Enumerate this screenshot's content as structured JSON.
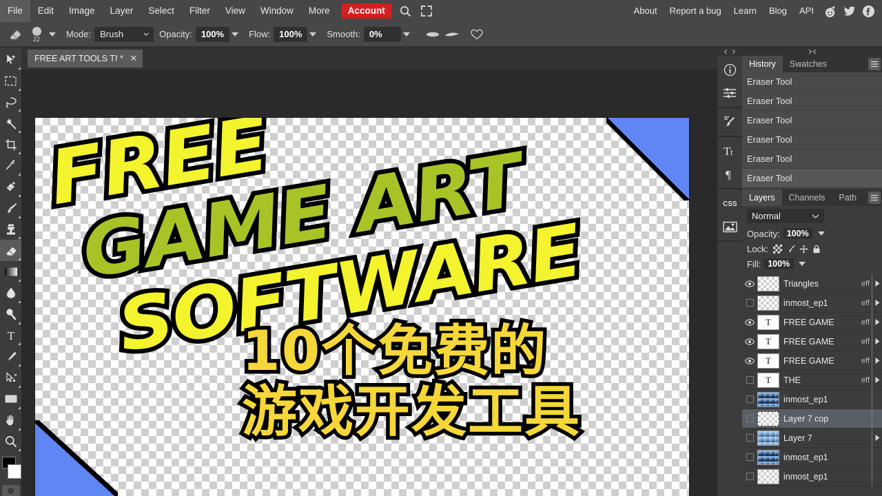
{
  "menu": {
    "left_items": [
      {
        "label": "File",
        "name": "menu-file"
      },
      {
        "label": "Edit",
        "name": "menu-edit"
      },
      {
        "label": "Image",
        "name": "menu-image"
      },
      {
        "label": "Layer",
        "name": "menu-layer"
      },
      {
        "label": "Select",
        "name": "menu-select"
      },
      {
        "label": "Filter",
        "name": "menu-filter"
      },
      {
        "label": "View",
        "name": "menu-view"
      },
      {
        "label": "Window",
        "name": "menu-window"
      },
      {
        "label": "More",
        "name": "menu-more"
      }
    ],
    "account_label": "Account",
    "account_color": "#d21f21",
    "search_icon": "search-icon",
    "fullscreen_icon": "fullscreen-icon",
    "right_items": [
      {
        "label": "About",
        "name": "menu-about"
      },
      {
        "label": "Report a bug",
        "name": "menu-report-a-bug"
      },
      {
        "label": "Learn",
        "name": "menu-learn"
      },
      {
        "label": "Blog",
        "name": "menu-blog"
      },
      {
        "label": "API",
        "name": "menu-api"
      }
    ],
    "social": [
      {
        "name": "reddit-icon"
      },
      {
        "name": "twitter-icon"
      },
      {
        "name": "facebook-icon"
      }
    ]
  },
  "options_bar": {
    "tool_icon": "eraser-icon",
    "brush_size": "22",
    "mode_label": "Mode:",
    "mode_value": "Brush",
    "opacity_label": "Opacity:",
    "opacity_value": "100%",
    "flow_label": "Flow:",
    "flow_value": "100%",
    "smooth_label": "Smooth:",
    "smooth_value": "0%",
    "extra_icons": [
      "airbrush-icon",
      "pressure-icon",
      "heart-icon"
    ]
  },
  "toolbar": {
    "tools": [
      {
        "name": "move-tool",
        "active": false
      },
      {
        "name": "marquee-tool",
        "active": false
      },
      {
        "name": "lasso-tool",
        "active": false
      },
      {
        "name": "magic-wand-tool",
        "active": false
      },
      {
        "name": "crop-tool",
        "active": false
      },
      {
        "name": "eyedropper-tool",
        "active": false
      },
      {
        "name": "healing-tool",
        "active": false
      },
      {
        "name": "brush-tool",
        "active": false
      },
      {
        "name": "clone-stamp-tool",
        "active": false
      },
      {
        "name": "eraser-tool",
        "active": true
      },
      {
        "name": "gradient-tool",
        "active": false
      },
      {
        "name": "blur-tool",
        "active": false
      },
      {
        "name": "dodge-tool",
        "active": false
      },
      {
        "name": "type-tool",
        "active": false
      },
      {
        "name": "pen-tool",
        "active": false
      },
      {
        "name": "path-select-tool",
        "active": false
      },
      {
        "name": "shape-tool",
        "active": false
      },
      {
        "name": "hand-tool",
        "active": false
      },
      {
        "name": "zoom-tool",
        "active": false
      }
    ],
    "foreground_color": "#000000",
    "background_color": "#ffffff"
  },
  "document_tab": {
    "name": "FREE ART TOOLS TN.p",
    "modified_mark": "*",
    "close_label": "✕"
  },
  "canvas": {
    "art_lines": [
      "FREE",
      "GAME ART",
      "SOFTWARE"
    ],
    "art_colors": [
      "#f3f32e",
      "#a8c326",
      "#f3f32e"
    ],
    "chinese_lines": [
      "10个免费的",
      "游戏开发工具"
    ],
    "chinese_color": "#f5d73a",
    "corner_triangle_color": "#5f86f2",
    "outline_color": "#000000"
  },
  "right_strip": {
    "groups": [
      [
        "info-icon",
        "adjustments-icon"
      ],
      [
        "brush-panel-icon"
      ],
      [
        "character-icon",
        "paragraph-icon"
      ],
      [
        "css-icon",
        "image-panel-icon"
      ]
    ]
  },
  "history_panel": {
    "tabs": [
      {
        "label": "History",
        "active": true
      },
      {
        "label": "Swatches",
        "active": false
      }
    ],
    "menu_icon": "hamburger-icon",
    "items": [
      {
        "label": "Eraser Tool",
        "selected": false
      },
      {
        "label": "Eraser Tool",
        "selected": false
      },
      {
        "label": "Eraser Tool",
        "selected": false
      },
      {
        "label": "Eraser Tool",
        "selected": false
      },
      {
        "label": "Eraser Tool",
        "selected": false
      },
      {
        "label": "Eraser Tool",
        "selected": true
      }
    ]
  },
  "layers_panel": {
    "tabs": [
      {
        "label": "Layers",
        "active": true
      },
      {
        "label": "Channels",
        "active": false
      },
      {
        "label": "Path",
        "active": false
      }
    ],
    "menu_icon": "hamburger-icon",
    "blend_mode": "Normal",
    "opacity_label": "Opacity:",
    "opacity_value": "100%",
    "lock_label": "Lock:",
    "lock_icons": [
      "lock-transparency-icon",
      "lock-pixels-icon",
      "lock-position-icon",
      "lock-all-icon"
    ],
    "fill_label": "Fill:",
    "fill_value": "100%",
    "layers": [
      {
        "name": "Triangles",
        "visible": true,
        "thumb": "transparent",
        "effects": "eff",
        "expand": true,
        "selected": false
      },
      {
        "name": "inmost_ep1",
        "visible": false,
        "thumb": "transparent",
        "effects": "eff",
        "expand": true,
        "selected": false
      },
      {
        "name": "FREE GAME",
        "visible": true,
        "thumb": "text",
        "effects": "eff",
        "expand": true,
        "selected": false
      },
      {
        "name": "FREE GAME",
        "visible": true,
        "thumb": "text",
        "effects": "eff",
        "expand": true,
        "selected": false
      },
      {
        "name": "FREE GAME",
        "visible": true,
        "thumb": "text",
        "effects": "eff",
        "expand": true,
        "selected": false
      },
      {
        "name": "THE",
        "visible": false,
        "thumb": "text",
        "effects": "eff",
        "expand": true,
        "selected": false
      },
      {
        "name": "inmost_ep1",
        "visible": false,
        "thumb": "photo",
        "effects": "",
        "expand": false,
        "selected": false
      },
      {
        "name": "Layer 7 cop",
        "visible": false,
        "thumb": "transparent-sel",
        "effects": "",
        "expand": false,
        "selected": true
      },
      {
        "name": "Layer 7",
        "visible": false,
        "thumb": "photo2",
        "effects": "",
        "expand": true,
        "selected": false
      },
      {
        "name": "inmost_ep1",
        "visible": false,
        "thumb": "photo",
        "effects": "",
        "expand": false,
        "selected": false
      },
      {
        "name": "inmost_ep1",
        "visible": false,
        "thumb": "transparent",
        "effects": "",
        "expand": false,
        "selected": false
      }
    ]
  }
}
